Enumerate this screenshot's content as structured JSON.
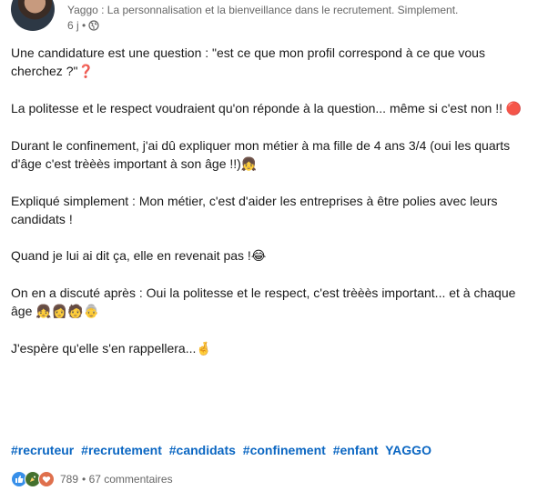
{
  "post": {
    "author_line": "Yaggo : La personnalisation et la bienveillance dans le recrutement. Simplement.",
    "time": "6 j •",
    "paragraphs": [
      {
        "text": "Une candidature est une question : \"est ce que mon profil correspond à ce que vous cherchez ?\"",
        "emoji": "❓"
      },
      {
        "text": "La politesse et le respect voudraient qu'on réponde à la question... même si c'est non !! ",
        "emoji": "🔴"
      },
      {
        "text": "Durant le confinement, j'ai dû expliquer mon métier à ma fille de 4 ans 3/4 (oui les quarts d'âge c'est trèèès important à son âge !!)",
        "emoji": "👧"
      },
      {
        "text": "Expliqué simplement : Mon métier, c'est d'aider les entreprises à être polies avec leurs candidats !",
        "emoji": ""
      },
      {
        "text": "Quand je lui ai dit ça, elle en revenait pas !",
        "emoji": "😂"
      },
      {
        "text": "On en a discuté après : Oui la politesse et le respect, c'est trèèès important... et à chaque âge ",
        "emoji": "👧👩🧑👵"
      },
      {
        "text": "J'espère qu'elle s'en rappellera...",
        "emoji": "🤞"
      }
    ],
    "hashtags": [
      "#recruteur",
      "#recrutement",
      "#candidats",
      "#confinement",
      "#enfant",
      "YAGGO"
    ],
    "reactions": {
      "count": "789",
      "comments": "• 67 commentaires",
      "icons": [
        "like-icon",
        "celebrate-icon",
        "love-icon"
      ]
    }
  },
  "colors": {
    "link": "#0a66c2",
    "meta": "#666666",
    "like": "#378fe9",
    "celebrate": "#44712e",
    "love": "#df704d"
  }
}
